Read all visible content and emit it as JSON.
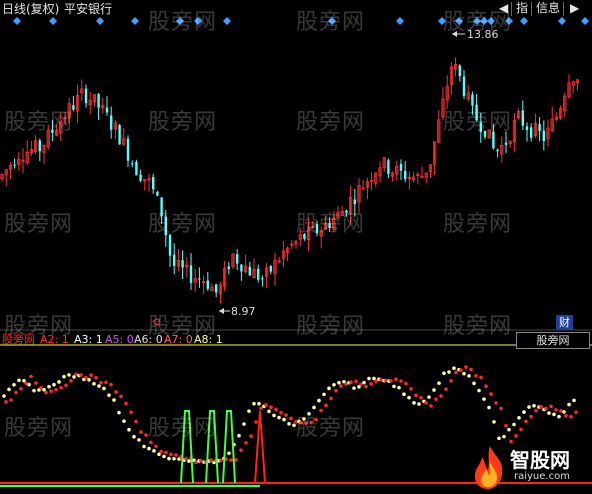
{
  "header": {
    "chart_title": "日线(复权)",
    "stock_name": "平安银行",
    "btn_left": "◀",
    "btn_index": "指",
    "btn_info": "信息",
    "btn_right": "▶"
  },
  "price_labels": {
    "high": "13.86",
    "low": "8.97"
  },
  "watermark": "股旁网",
  "cai_badge": "财",
  "panel_switch": "股旁网",
  "indicator_legend": [
    {
      "text": "股旁网",
      "color": "#ff2020"
    },
    {
      "text": "A2: 1",
      "color": "#ff3030"
    },
    {
      "text": "A3: 1",
      "color": "#ffffff"
    },
    {
      "text": "A5: 0",
      "color": "#d050ff"
    },
    {
      "text": "A6: 0",
      "color": "#e0e0e0"
    },
    {
      "text": "A7: 0",
      "color": "#ff6060"
    },
    {
      "text": "A8: 1",
      "color": "#ffff80"
    }
  ],
  "brand": {
    "name": "智股网",
    "url": "raiyue.com"
  },
  "colors": {
    "up": "#ff3030",
    "down": "#54ffff",
    "diamond": "#3fa0ff",
    "dot_red": "#ff2828",
    "dot_yellow": "#ffffa0",
    "line_green": "#40ff40",
    "line_red": "#ff2020",
    "separator": "#ffff40"
  },
  "chart_data": {
    "type": "candlestick",
    "period": "daily",
    "price_marks": [
      13.86,
      8.97
    ],
    "ohlc_approx": [
      [
        11.4,
        11.9,
        11.0,
        11.6
      ],
      [
        11.6,
        12.1,
        11.2,
        11.3
      ],
      [
        11.3,
        11.9,
        11.1,
        11.8
      ],
      [
        11.8,
        12.2,
        11.5,
        11.6
      ],
      [
        11.6,
        12.0,
        11.3,
        11.9
      ],
      [
        11.9,
        12.4,
        11.7,
        12.2
      ],
      [
        12.2,
        12.6,
        11.9,
        12.0
      ],
      [
        12.0,
        12.5,
        11.8,
        12.4
      ],
      [
        12.4,
        12.9,
        12.1,
        12.3
      ],
      [
        12.3,
        12.8,
        12.0,
        12.6
      ],
      [
        12.6,
        13.2,
        12.4,
        12.5
      ],
      [
        12.5,
        13.0,
        12.2,
        12.8
      ],
      [
        12.8,
        13.3,
        12.6,
        12.7
      ],
      [
        12.7,
        13.1,
        12.3,
        12.4
      ],
      [
        12.4,
        12.9,
        12.0,
        12.1
      ],
      [
        12.1,
        12.5,
        11.6,
        11.8
      ],
      [
        11.8,
        12.2,
        11.2,
        11.4
      ],
      [
        11.4,
        11.9,
        11.0,
        11.6
      ],
      [
        11.6,
        12.0,
        11.2,
        11.3
      ],
      [
        11.3,
        11.7,
        10.8,
        11.0
      ],
      [
        11.0,
        11.4,
        10.4,
        10.6
      ],
      [
        10.6,
        11.0,
        10.0,
        10.2
      ],
      [
        10.2,
        10.6,
        9.6,
        9.8
      ],
      [
        9.8,
        10.2,
        9.3,
        9.5
      ],
      [
        9.5,
        9.9,
        9.1,
        9.6
      ],
      [
        9.6,
        10.0,
        9.2,
        9.3
      ],
      [
        9.3,
        9.7,
        8.97,
        9.2
      ],
      [
        9.2,
        9.9,
        9.1,
        9.8
      ],
      [
        9.8,
        10.5,
        9.6,
        10.3
      ],
      [
        10.3,
        10.9,
        10.0,
        10.1
      ],
      [
        10.1,
        10.6,
        9.8,
        10.4
      ],
      [
        10.4,
        10.9,
        10.1,
        10.2
      ],
      [
        10.2,
        10.7,
        9.9,
        10.5
      ],
      [
        10.5,
        11.0,
        10.2,
        10.8
      ],
      [
        10.8,
        11.3,
        10.5,
        10.6
      ],
      [
        10.6,
        11.1,
        10.3,
        10.9
      ],
      [
        10.9,
        11.4,
        10.6,
        11.2
      ],
      [
        11.2,
        11.7,
        10.9,
        11.0
      ],
      [
        11.0,
        11.5,
        10.7,
        11.3
      ],
      [
        11.3,
        11.8,
        11.0,
        11.6
      ],
      [
        11.6,
        12.4,
        11.4,
        12.2
      ],
      [
        12.2,
        13.0,
        12.0,
        12.8
      ],
      [
        12.8,
        13.86,
        12.6,
        13.3
      ],
      [
        13.3,
        13.7,
        12.8,
        12.9
      ],
      [
        12.9,
        13.3,
        12.4,
        12.6
      ],
      [
        12.6,
        12.9,
        12.0,
        12.2
      ],
      [
        12.2,
        12.7,
        11.9,
        12.5
      ],
      [
        12.5,
        12.9,
        12.1,
        12.3
      ],
      [
        12.3,
        12.8,
        12.0,
        12.6
      ],
      [
        12.6,
        13.1,
        12.3,
        12.9
      ],
      [
        12.9,
        13.6,
        12.7,
        13.4
      ]
    ]
  }
}
